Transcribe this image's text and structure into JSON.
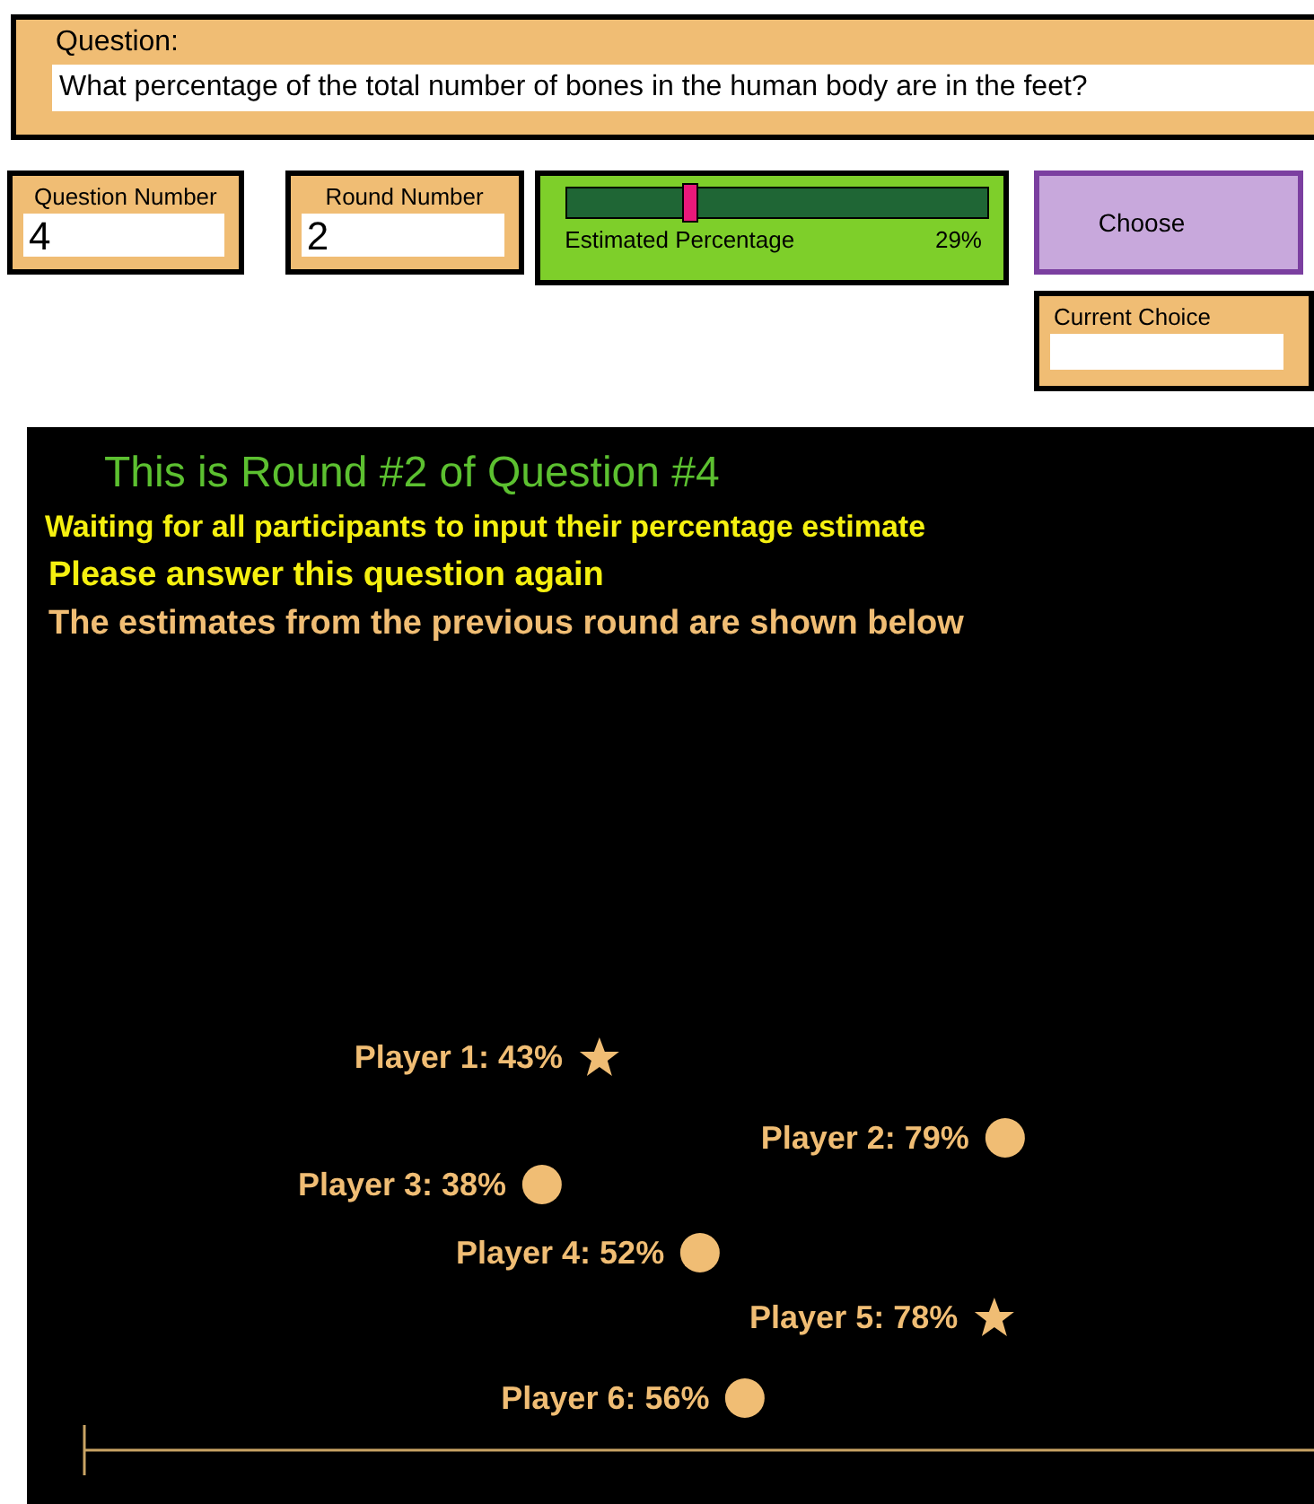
{
  "question": {
    "label": "Question:",
    "text": "What percentage of the total number of bones in the human body are in the feet?"
  },
  "question_number": {
    "label": "Question Number",
    "value": "4"
  },
  "round_number": {
    "label": "Round Number",
    "value": "2"
  },
  "estimate_slider": {
    "label": "Estimated Percentage",
    "level": 0.29,
    "reading": "29%"
  },
  "choose_button": {
    "label": "Choose"
  },
  "current_choice": {
    "label": "Current Choice"
  },
  "panel": {
    "heading": "This is Round #2 of Question #4",
    "status": "Waiting for all participants to input their percentage estimate",
    "instruction": "Please answer this question again",
    "note": "The estimates from the previous round are shown below",
    "players": [
      {
        "label": "Player 1: 43%",
        "level": 0.43,
        "kind": "star"
      },
      {
        "label": "Player 2: 79%",
        "level": 0.79,
        "kind": "circle"
      },
      {
        "label": "Player 3: 38%",
        "level": 0.38,
        "kind": "circle"
      },
      {
        "label": "Player 4: 52%",
        "level": 0.52,
        "kind": "circle"
      },
      {
        "label": "Player 5: 78%",
        "level": 0.78,
        "kind": "star"
      },
      {
        "label": "Player 6: 56%",
        "level": 0.56,
        "kind": "circle"
      }
    ]
  }
}
